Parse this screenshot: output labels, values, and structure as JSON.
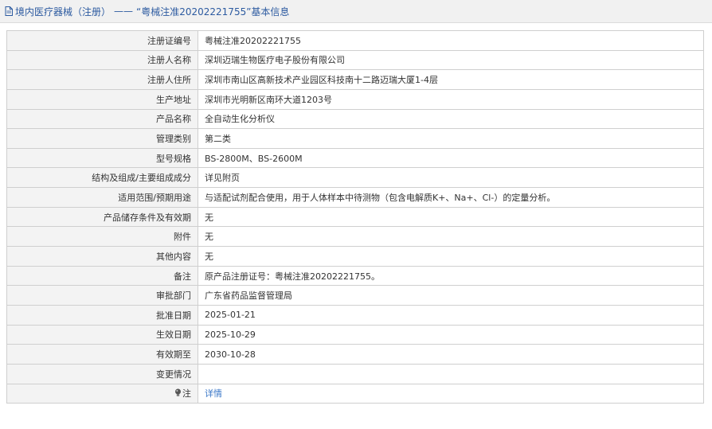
{
  "header": {
    "category": "境内医疗器械（注册）",
    "separator": "——",
    "title": "“粤械注准20202221755”基本信息"
  },
  "rows": [
    {
      "label": "注册证编号",
      "value": "粤械注准20202221755"
    },
    {
      "label": "注册人名称",
      "value": "深圳迈瑞生物医疗电子股份有限公司"
    },
    {
      "label": "注册人住所",
      "value": "深圳市南山区高新技术产业园区科技南十二路迈瑞大厦1-4层"
    },
    {
      "label": "生产地址",
      "value": "深圳市光明新区南环大道1203号"
    },
    {
      "label": "产品名称",
      "value": "全自动生化分析仪"
    },
    {
      "label": "管理类别",
      "value": "第二类"
    },
    {
      "label": "型号规格",
      "value": "BS-2800M、BS-2600M"
    },
    {
      "label": "结构及组成/主要组成成分",
      "value": "详见附页"
    },
    {
      "label": "适用范围/预期用途",
      "value": "与适配试剂配合使用，用于人体样本中待测物（包含电解质K+、Na+、Cl-）的定量分析。"
    },
    {
      "label": "产品储存条件及有效期",
      "value": "无"
    },
    {
      "label": "附件",
      "value": "无"
    },
    {
      "label": "其他内容",
      "value": "无"
    },
    {
      "label": "备注",
      "value": "原产品注册证号：粤械注准20202221755。"
    },
    {
      "label": "审批部门",
      "value": "广东省药品监督管理局"
    },
    {
      "label": "批准日期",
      "value": "2025-01-21"
    },
    {
      "label": "生效日期",
      "value": "2025-10-29"
    },
    {
      "label": "有效期至",
      "value": "2030-10-28"
    },
    {
      "label": "变更情况",
      "value": ""
    }
  ],
  "note": {
    "label": "注",
    "link_text": "详情",
    "icon": "bulb-icon"
  },
  "colors": {
    "header_text": "#2c5aa0",
    "link": "#3a77c8",
    "label_bg": "#f3f3f3",
    "border": "#cfcfcf"
  }
}
